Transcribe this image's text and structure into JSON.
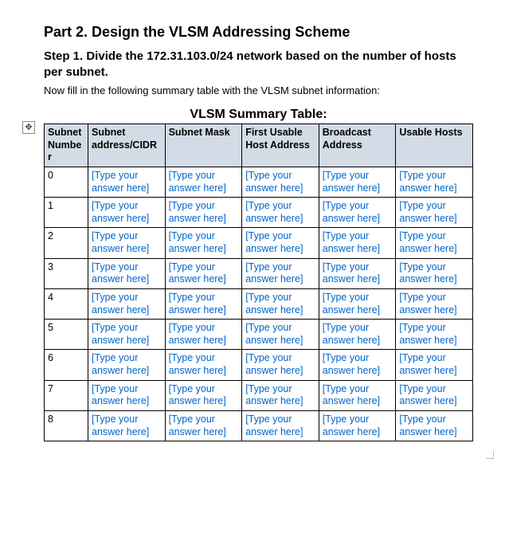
{
  "headings": {
    "part": "Part 2. Design the VLSM Addressing Scheme",
    "step": "Step 1. Divide the 172.31.103.0/24 network based on the number of hosts per subnet.",
    "instruction": "Now fill in the following summary table with the VLSM subnet information:",
    "table_title": "VLSM Summary Table:"
  },
  "anchor_glyph": "✥",
  "columns": [
    "Subnet Number",
    "Subnet address/CIDR",
    "Subnet Mask",
    "First Usable Host Address",
    "Broadcast Address",
    "Usable Hosts"
  ],
  "placeholder": "[Type your answer here]",
  "rows": [
    {
      "num": "0",
      "cells": [
        "[Type your answer here]",
        "[Type your answer here]",
        "[Type your answer here]",
        "[Type your answer here]",
        "[Type your answer here]"
      ]
    },
    {
      "num": "1",
      "cells": [
        "[Type your answer here]",
        "[Type your answer here]",
        "[Type your answer here]",
        "[Type your answer here]",
        "[Type your answer here]"
      ]
    },
    {
      "num": "2",
      "cells": [
        "[Type your answer here]",
        "[Type your answer here]",
        "[Type your answer here]",
        "[Type your answer here]",
        "[Type your answer here]"
      ]
    },
    {
      "num": "3",
      "cells": [
        "[Type your answer here]",
        "[Type your answer here]",
        "[Type your answer here]",
        "[Type your answer here]",
        "[Type your answer here]"
      ]
    },
    {
      "num": "4",
      "cells": [
        "[Type your answer here]",
        "[Type your answer here]",
        "[Type your answer here]",
        "[Type your answer here]",
        "[Type your answer here]"
      ]
    },
    {
      "num": "5",
      "cells": [
        "[Type your answer here]",
        "[Type your answer here]",
        "[Type your answer here]",
        "[Type your answer here]",
        "[Type your answer here]"
      ]
    },
    {
      "num": "6",
      "cells": [
        "[Type your answer here]",
        "[Type your answer here]",
        "[Type your answer here]",
        "[Type your answer here]",
        "[Type your answer here]"
      ]
    },
    {
      "num": "7",
      "cells": [
        "[Type your answer here]",
        "[Type your answer here]",
        "[Type your answer here]",
        "[Type your answer here]",
        "[Type your answer here]"
      ]
    },
    {
      "num": "8",
      "cells": [
        "[Type your answer here]",
        "[Type your answer here]",
        "[Type your answer here]",
        "[Type your answer here]",
        "[Type your answer here]"
      ]
    }
  ]
}
